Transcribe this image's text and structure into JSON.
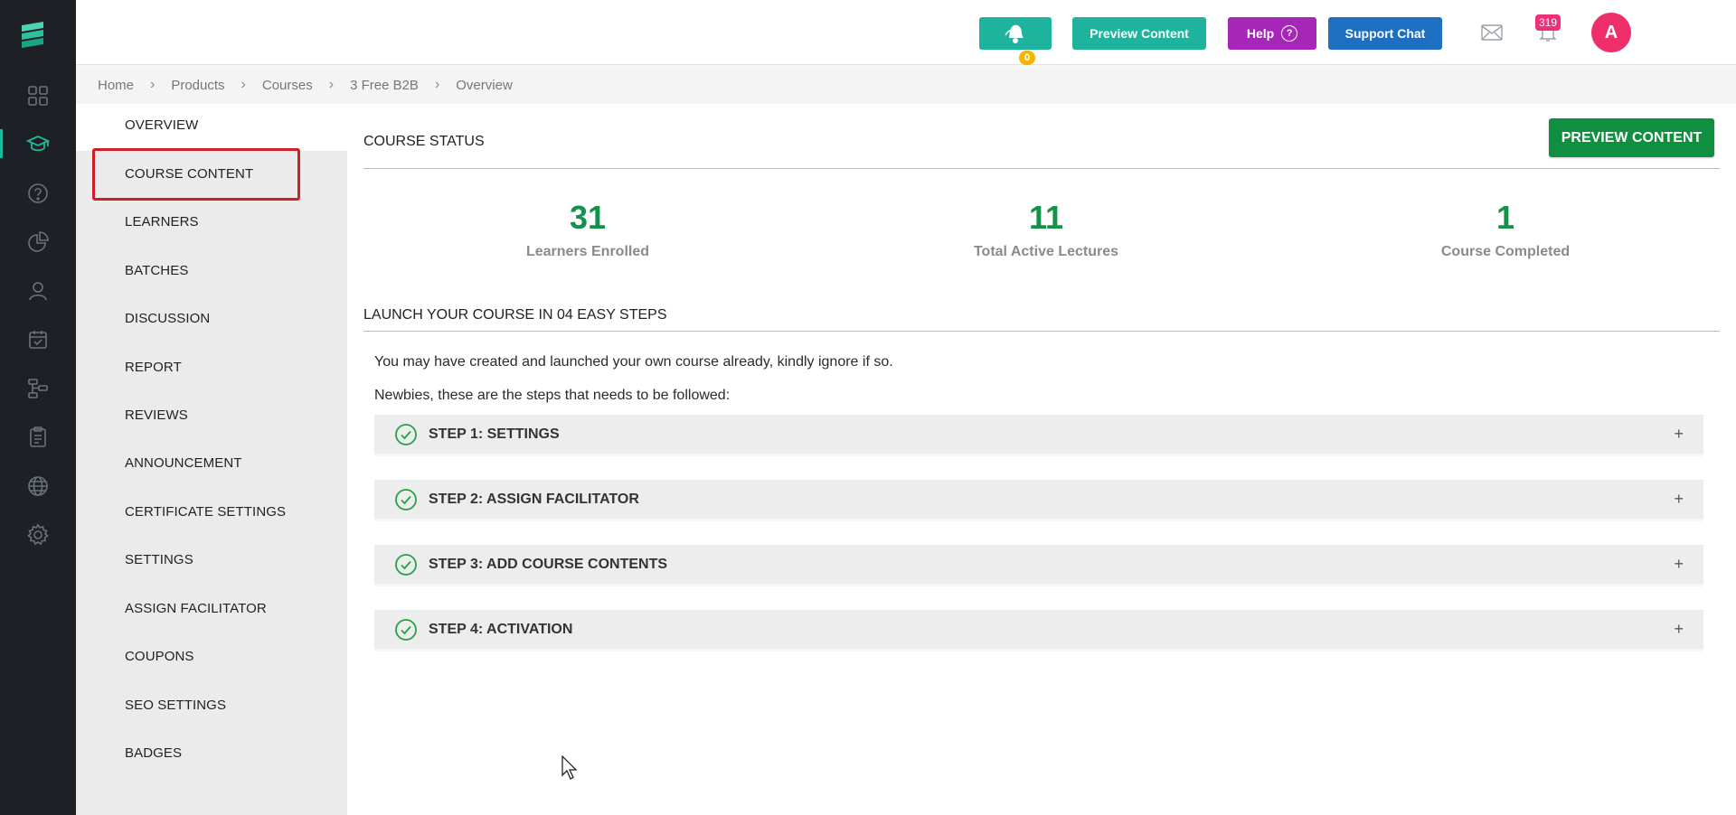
{
  "header": {
    "bell_count": "0",
    "preview_label": "Preview Content",
    "help_label": "Help",
    "help_icon": "?",
    "support_label": "Support Chat",
    "notification_count": "319",
    "avatar_initial": "A"
  },
  "breadcrumb": [
    "Home",
    "Products",
    "Courses",
    "3 Free B2B",
    "Overview"
  ],
  "subnav": {
    "items": [
      "OVERVIEW",
      "COURSE CONTENT",
      "LEARNERS",
      "BATCHES",
      "DISCUSSION",
      "REPORT",
      "REVIEWS",
      "ANNOUNCEMENT",
      "CERTIFICATE SETTINGS",
      "SETTINGS",
      "ASSIGN FACILITATOR",
      "COUPONS",
      "SEO SETTINGS",
      "BADGES"
    ]
  },
  "main": {
    "status_title": "COURSE STATUS",
    "preview_button": "PREVIEW CONTENT",
    "stats": [
      {
        "value": "31",
        "label": "Learners Enrolled"
      },
      {
        "value": "11",
        "label": "Total Active Lectures"
      },
      {
        "value": "1",
        "label": "Course Completed"
      }
    ],
    "launch_title": "LAUNCH YOUR COURSE IN 04 EASY STEPS",
    "para1": "You may have created and launched your own course already, kindly ignore if so.",
    "para2": "Newbies, these are the steps that needs to be followed:",
    "steps": [
      "STEP 1: SETTINGS",
      "STEP 2: ASSIGN FACILITATOR",
      "STEP 3: ADD COURSE CONTENTS",
      "STEP 4: ACTIVATION"
    ],
    "expand_symbol": "+"
  },
  "colors": {
    "rail_bg": "#1d2126",
    "accent_teal": "#1db39c",
    "help_purple": "#a626b8",
    "support_blue": "#1e6fc2",
    "preview_green": "#0f8f3f",
    "stat_green": "#14924a",
    "highlight_red": "#cc1f27",
    "badge_pink": "#ee2f7a"
  },
  "icons": {
    "rail": [
      "logo-icon",
      "dashboard-icon",
      "courses-icon",
      "help-circle-icon",
      "reports-pie-icon",
      "user-icon",
      "calendar-check-icon",
      "workflow-icon",
      "clipboard-icon",
      "globe-icon",
      "gear-icon"
    ]
  }
}
